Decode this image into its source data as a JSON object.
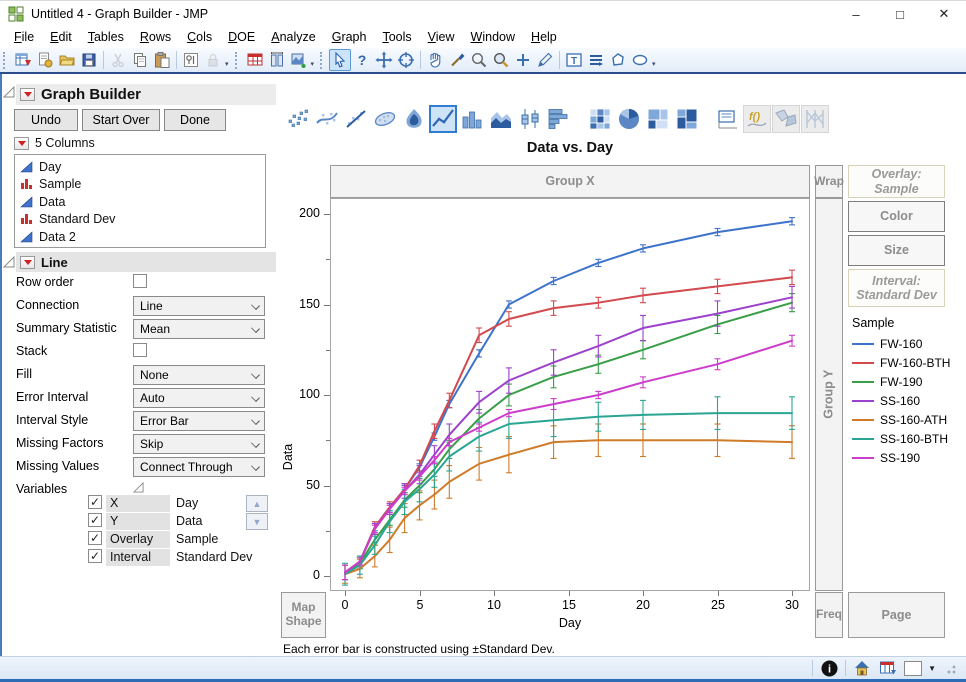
{
  "window": {
    "title": "Untitled 4 - Graph Builder - JMP"
  },
  "menus": [
    "File",
    "Edit",
    "Tables",
    "Rows",
    "Cols",
    "DOE",
    "Analyze",
    "Graph",
    "Tools",
    "View",
    "Window",
    "Help"
  ],
  "toolbar": {
    "items": [
      {
        "t": "grip"
      },
      {
        "t": "icon",
        "n": "new-journal"
      },
      {
        "t": "icon",
        "n": "new-script"
      },
      {
        "t": "icon",
        "n": "open"
      },
      {
        "t": "icon",
        "n": "save"
      },
      {
        "t": "sep"
      },
      {
        "t": "icon",
        "n": "cut",
        "disabled": true
      },
      {
        "t": "icon",
        "n": "copy"
      },
      {
        "t": "icon",
        "n": "paste"
      },
      {
        "t": "sep"
      },
      {
        "t": "icon",
        "n": "properties"
      },
      {
        "t": "icon",
        "n": "lock",
        "disabled": true
      },
      {
        "t": "drop"
      },
      {
        "t": "grip"
      },
      {
        "t": "icon",
        "n": "data-table"
      },
      {
        "t": "icon",
        "n": "column-info"
      },
      {
        "t": "icon",
        "n": "add-graph"
      },
      {
        "t": "drop"
      },
      {
        "t": "grip"
      },
      {
        "t": "icon",
        "n": "arrow-cursor",
        "selected": true
      },
      {
        "t": "icon",
        "n": "help"
      },
      {
        "t": "icon",
        "n": "move"
      },
      {
        "t": "icon",
        "n": "target"
      },
      {
        "t": "sep"
      },
      {
        "t": "icon",
        "n": "hand"
      },
      {
        "t": "icon",
        "n": "brush"
      },
      {
        "t": "icon",
        "n": "lasso"
      },
      {
        "t": "icon",
        "n": "magnifier"
      },
      {
        "t": "icon",
        "n": "crosshair"
      },
      {
        "t": "icon",
        "n": "pencil"
      },
      {
        "t": "sep"
      },
      {
        "t": "icon",
        "n": "text-box"
      },
      {
        "t": "icon",
        "n": "lines"
      },
      {
        "t": "icon",
        "n": "polygon"
      },
      {
        "t": "icon",
        "n": "oval"
      },
      {
        "t": "drop"
      }
    ]
  },
  "panel": {
    "title": "Graph Builder",
    "buttons": [
      "Undo",
      "Start Over",
      "Done"
    ],
    "columns_header": "5 Columns",
    "columns": [
      {
        "name": "Day",
        "type": "continuous"
      },
      {
        "name": "Sample",
        "type": "nominal"
      },
      {
        "name": "Data",
        "type": "continuous"
      },
      {
        "name": "Standard Dev",
        "type": "nominal"
      },
      {
        "name": "Data 2",
        "type": "continuous"
      }
    ],
    "line_section": {
      "title": "Line",
      "rows": [
        {
          "label": "Row order",
          "control": "checkbox",
          "checked": false
        },
        {
          "label": "Connection",
          "control": "select",
          "value": "Line"
        },
        {
          "label": "Summary Statistic",
          "control": "select",
          "value": "Mean"
        },
        {
          "label": "Stack",
          "control": "checkbox",
          "checked": false
        },
        {
          "label": "Fill",
          "control": "select",
          "value": "None"
        },
        {
          "label": "Error Interval",
          "control": "select",
          "value": "Auto"
        },
        {
          "label": "Interval Style",
          "control": "select",
          "value": "Error Bar"
        },
        {
          "label": "Missing Factors",
          "control": "select",
          "value": "Skip"
        },
        {
          "label": "Missing Values",
          "control": "select",
          "value": "Connect Through"
        },
        {
          "label": "Variables",
          "control": "disclosure"
        }
      ],
      "variables": [
        {
          "zone": "X",
          "column": "Day",
          "checked": true,
          "arrow": "up"
        },
        {
          "zone": "Y",
          "column": "Data",
          "checked": true,
          "arrow": "down"
        },
        {
          "zone": "Overlay",
          "column": "Sample",
          "checked": true
        },
        {
          "zone": "Interval",
          "column": "Standard Dev",
          "checked": true
        }
      ]
    }
  },
  "gallery": [
    {
      "n": "points"
    },
    {
      "n": "smoother"
    },
    {
      "n": "line-of-fit"
    },
    {
      "n": "ellipse"
    },
    {
      "n": "contour"
    },
    {
      "n": "line",
      "selected": true
    },
    {
      "n": "bar"
    },
    {
      "n": "area"
    },
    {
      "n": "box-plot"
    },
    {
      "n": "histogram"
    },
    {
      "n": "gap"
    },
    {
      "n": "heatmap"
    },
    {
      "n": "pie"
    },
    {
      "n": "treemap"
    },
    {
      "n": "mosaic"
    },
    {
      "n": "gap"
    },
    {
      "n": "caption-box"
    },
    {
      "n": "formula",
      "disabled": true
    },
    {
      "n": "map-shapes",
      "disabled": true
    },
    {
      "n": "parallel",
      "disabled": true
    }
  ],
  "canvas": {
    "zones": {
      "group_x": "Group X",
      "wrap": "Wrap",
      "group_y": "Group Y",
      "map_shape": "Map Shape",
      "freq": "Freq",
      "page": "Page",
      "overlay": "Overlay: Sample",
      "color": "Color",
      "size": "Size",
      "interval_line1": "Interval:",
      "interval_line2": "Standard Dev"
    },
    "legend": {
      "title": "Sample"
    },
    "footnote": "Each error bar is constructed using ±Standard Dev."
  },
  "chart_data": {
    "type": "line",
    "title": "Data vs. Day",
    "xlabel": "Day",
    "ylabel": "Data",
    "xlim": [
      0,
      30
    ],
    "ylim": [
      0,
      200
    ],
    "x_ticks_major": [
      0,
      5,
      10,
      15,
      20,
      25,
      30
    ],
    "y_ticks_major": [
      0,
      50,
      100,
      150,
      200
    ],
    "y_ticks_minor": [
      25,
      75,
      125,
      175
    ],
    "legend_position": "right",
    "grid": false,
    "error_bars": "±Standard Dev",
    "x": [
      0,
      1,
      2,
      3,
      4,
      5,
      6,
      7,
      9,
      11,
      14,
      17,
      20,
      25,
      30
    ],
    "series": [
      {
        "name": "FW-160",
        "color": "#3e73cc",
        "values": [
          2,
          8,
          27,
          38,
          48,
          60,
          77,
          95,
          123,
          150,
          163,
          173,
          181,
          190,
          196
        ],
        "stddev": [
          4,
          2,
          2,
          2,
          2,
          2,
          2,
          2,
          2,
          2,
          2,
          2,
          2,
          2,
          2
        ]
      },
      {
        "name": "FW-160-BTH",
        "color": "#d2494e",
        "values": [
          2,
          8,
          27,
          38,
          48,
          61,
          80,
          97,
          133,
          142,
          148,
          151,
          155,
          160,
          165
        ],
        "stddev": [
          4,
          2,
          3,
          3,
          3,
          3,
          4,
          4,
          4,
          4,
          4,
          3,
          4,
          4,
          4
        ]
      },
      {
        "name": "FW-190",
        "color": "#399e47",
        "values": [
          2,
          7,
          20,
          31,
          42,
          50,
          59,
          70,
          87,
          100,
          110,
          117,
          125,
          139,
          151
        ],
        "stddev": [
          4,
          3,
          3,
          3,
          4,
          4,
          4,
          5,
          5,
          6,
          6,
          5,
          5,
          5,
          5
        ]
      },
      {
        "name": "SS-160",
        "color": "#9c41cc",
        "values": [
          2,
          8,
          26,
          37,
          47,
          56,
          67,
          78,
          96,
          108,
          118,
          127,
          137,
          145,
          154
        ],
        "stddev": [
          4,
          3,
          3,
          3,
          4,
          5,
          5,
          6,
          6,
          7,
          7,
          6,
          7,
          7,
          6
        ]
      },
      {
        "name": "SS-160-ATH",
        "color": "#cf7b2a",
        "values": [
          1,
          4,
          11,
          20,
          32,
          39,
          45,
          52,
          62,
          67,
          74,
          75,
          75,
          75,
          74
        ],
        "stddev": [
          5,
          5,
          6,
          7,
          8,
          8,
          8,
          9,
          9,
          10,
          9,
          9,
          9,
          9,
          9
        ]
      },
      {
        "name": "SS-160-BTH",
        "color": "#2aa593",
        "values": [
          1,
          6,
          17,
          30,
          41,
          48,
          56,
          66,
          77,
          84,
          86,
          88,
          89,
          90,
          90
        ],
        "stddev": [
          6,
          5,
          5,
          6,
          7,
          7,
          7,
          8,
          8,
          8,
          9,
          8,
          8,
          9,
          9
        ]
      },
      {
        "name": "SS-190",
        "color": "#cc3dcb",
        "values": [
          2,
          8,
          26,
          37,
          47,
          55,
          64,
          74,
          82,
          90,
          95,
          100,
          107,
          117,
          130
        ],
        "stddev": [
          4,
          2,
          2,
          2,
          2,
          2,
          2,
          2,
          2,
          2,
          3,
          2,
          3,
          3,
          3
        ]
      }
    ]
  },
  "statusbar": {
    "icons": [
      "info",
      "home",
      "window-table"
    ]
  }
}
